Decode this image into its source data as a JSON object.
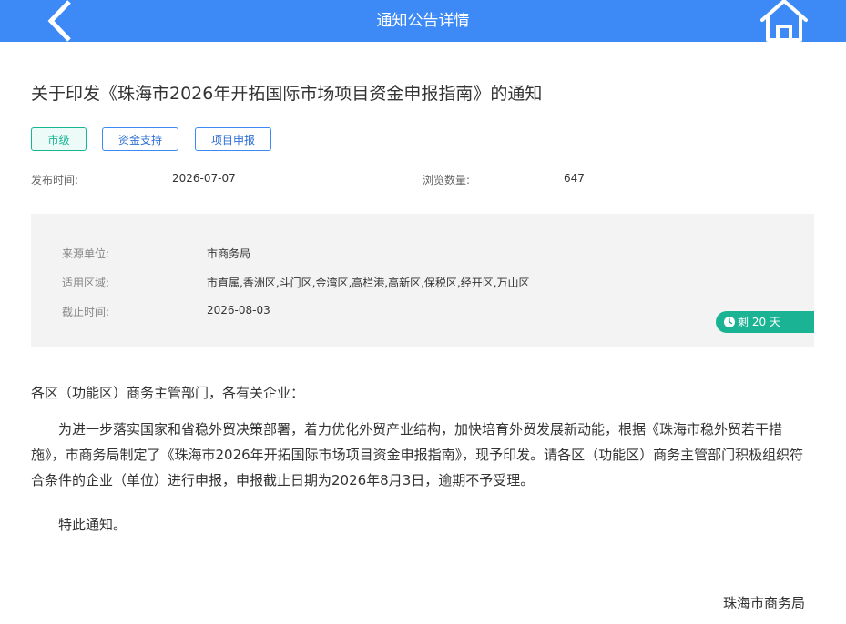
{
  "header": {
    "title": "通知公告详情",
    "back_icon": "chevron-left-icon",
    "home_icon": "home-icon",
    "bg_color": "#3d8af7"
  },
  "notice": {
    "title": "关于印发《珠海市2026年开拓国际市场项目资金申报指南》的通知",
    "tags": [
      "市级",
      "资金支持",
      "项目申报"
    ],
    "publish_label": "发布时间:",
    "publish_date": "2026-07-07",
    "views_label": "浏览数量:",
    "views": "647"
  },
  "info": {
    "source_label": "来源单位:",
    "source": "市商务局",
    "region_label": "适用区域:",
    "region": "市直属,香洲区,斗门区,金湾区,高栏港,高新区,保税区,经开区,万山区",
    "deadline_label": "截止时间:",
    "deadline": "2026-08-03",
    "remaining": "剩 20 天",
    "remaining_icon": "clock-icon",
    "badge_color": "#1ab393"
  },
  "content": {
    "greeting": "各区（功能区）商务主管部门，各有关企业：",
    "paragraph": "为进一步落实国家和省稳外贸决策部署，着力优化外贸产业结构，加快培育外贸发展新动能，根据《珠海市稳外贸若干措施》，市商务局制定了《珠海市2026年开拓国际市场项目资金申报指南》，现予印发。请各区（功能区）商务主管部门积极组织符合条件的企业（单位）进行申报，申报截止日期为2026年8月3日，逾期不予受理。",
    "closing": "特此通知。",
    "signature": "珠海市商务局"
  }
}
